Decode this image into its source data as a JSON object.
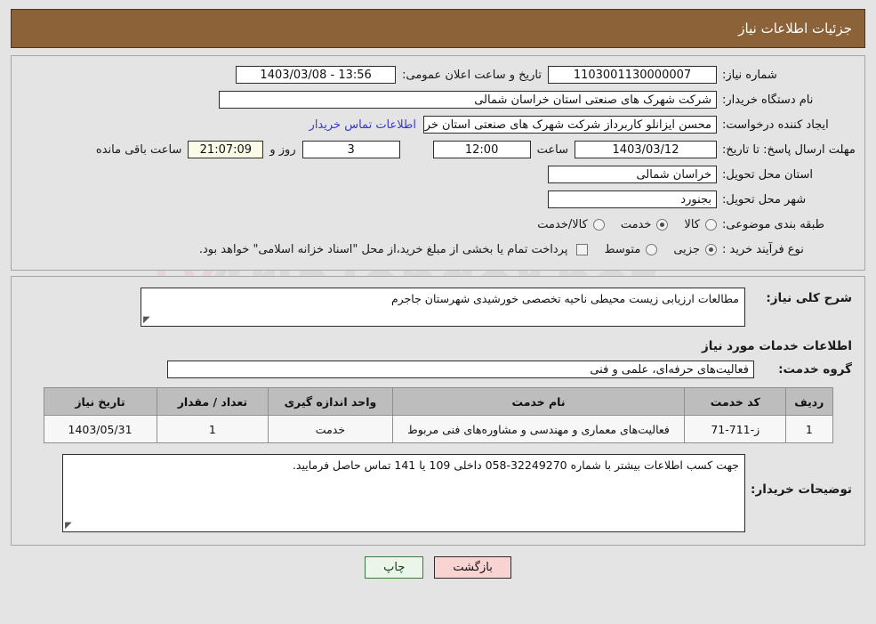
{
  "header": {
    "title": "جزئیات اطلاعات نیاز",
    "bg_color": "#8c6239"
  },
  "watermark": {
    "text": "AriaTender.net"
  },
  "form": {
    "need_number_label": "شماره نیاز:",
    "need_number_value": "1103001130000007",
    "public_announce_label": "تاریخ و ساعت اعلان عمومی:",
    "public_announce_value": "13:56 - 1403/03/08",
    "buyer_org_label": "نام دستگاه خریدار:",
    "buyer_org_value": "شرکت شهرک های صنعتی استان خراسان شمالی",
    "creator_label": "ایجاد کننده درخواست:",
    "creator_value": "محسن ایزانلو کاربرداز شرکت شهرک های صنعتی استان خراسان شمالی",
    "contact_link": "اطلاعات تماس خریدار",
    "deadline_label": "مهلت ارسال پاسخ: تا تاریخ:",
    "deadline_date": "1403/03/12",
    "hour_label": "ساعت",
    "hour_value": "12:00",
    "days_value": "3",
    "days_and_label": "روز و",
    "countdown_value": "21:07:09",
    "remaining_label": "ساعت باقی مانده",
    "province_label": "استان محل تحویل:",
    "province_value": "خراسان شمالی",
    "city_label": "شهر محل تحویل:",
    "city_value": "بجنورد",
    "category_label": "طبقه بندی موضوعی:",
    "category_options": [
      {
        "label": "کالا",
        "selected": false
      },
      {
        "label": "خدمت",
        "selected": true
      },
      {
        "label": "کالا/خدمت",
        "selected": false
      }
    ],
    "process_label": "نوع فرآیند خرید :",
    "process_options": [
      {
        "label": "جزیی",
        "selected": true
      },
      {
        "label": "متوسط",
        "selected": false
      }
    ],
    "treasury_checkbox_checked": false,
    "treasury_note": "پرداخت تمام یا بخشی از مبلغ خرید،از محل \"اسناد خزانه اسلامی\" خواهد بود."
  },
  "description": {
    "label": "شرح کلی نیاز:",
    "value": "مطالعات ارزیابی زیست محیطی ناحیه تخصصی خورشیدی شهرستان جاجرم"
  },
  "services_section": {
    "heading": "اطلاعات خدمات مورد نیاز",
    "group_label": "گروه خدمت:",
    "group_value": "فعالیت‌های حرفه‌ای، علمی و فنی"
  },
  "table": {
    "columns": [
      "ردیف",
      "کد خدمت",
      "نام خدمت",
      "واحد اندازه گیری",
      "تعداد / مقدار",
      "تاریخ نیاز"
    ],
    "rows": [
      {
        "radif": "1",
        "code": "ز-711-71",
        "name": "فعالیت‌های معماری و مهندسی و مشاوره‌های فنی مربوط",
        "unit": "خدمت",
        "qty": "1",
        "date": "1403/05/31"
      }
    ]
  },
  "buyer_notes": {
    "label": "توضیحات خریدار:",
    "value": "جهت کسب اطلاعات بیشتر با شماره 32249270-058 داخلی 109 یا 141 تماس حاصل فرمایید."
  },
  "buttons": {
    "print": "چاپ",
    "back": "بازگشت"
  }
}
